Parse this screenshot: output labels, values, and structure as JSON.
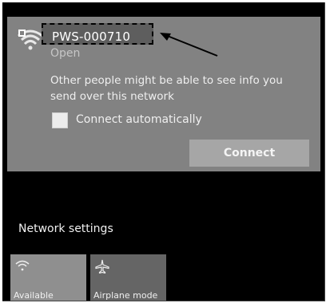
{
  "network": {
    "ssid": "PWS-000710",
    "status": "Open",
    "warning": "Other people might be able to see info you send over this network",
    "connect_automatically_label": "Connect automatically",
    "connect_automatically_checked": false,
    "connect_button": "Connect"
  },
  "settings": {
    "label": "Network settings"
  },
  "quick_actions": [
    {
      "label": "Available",
      "icon": "wifi-icon"
    },
    {
      "label": "Airplane mode",
      "icon": "airplane-icon"
    }
  ]
}
